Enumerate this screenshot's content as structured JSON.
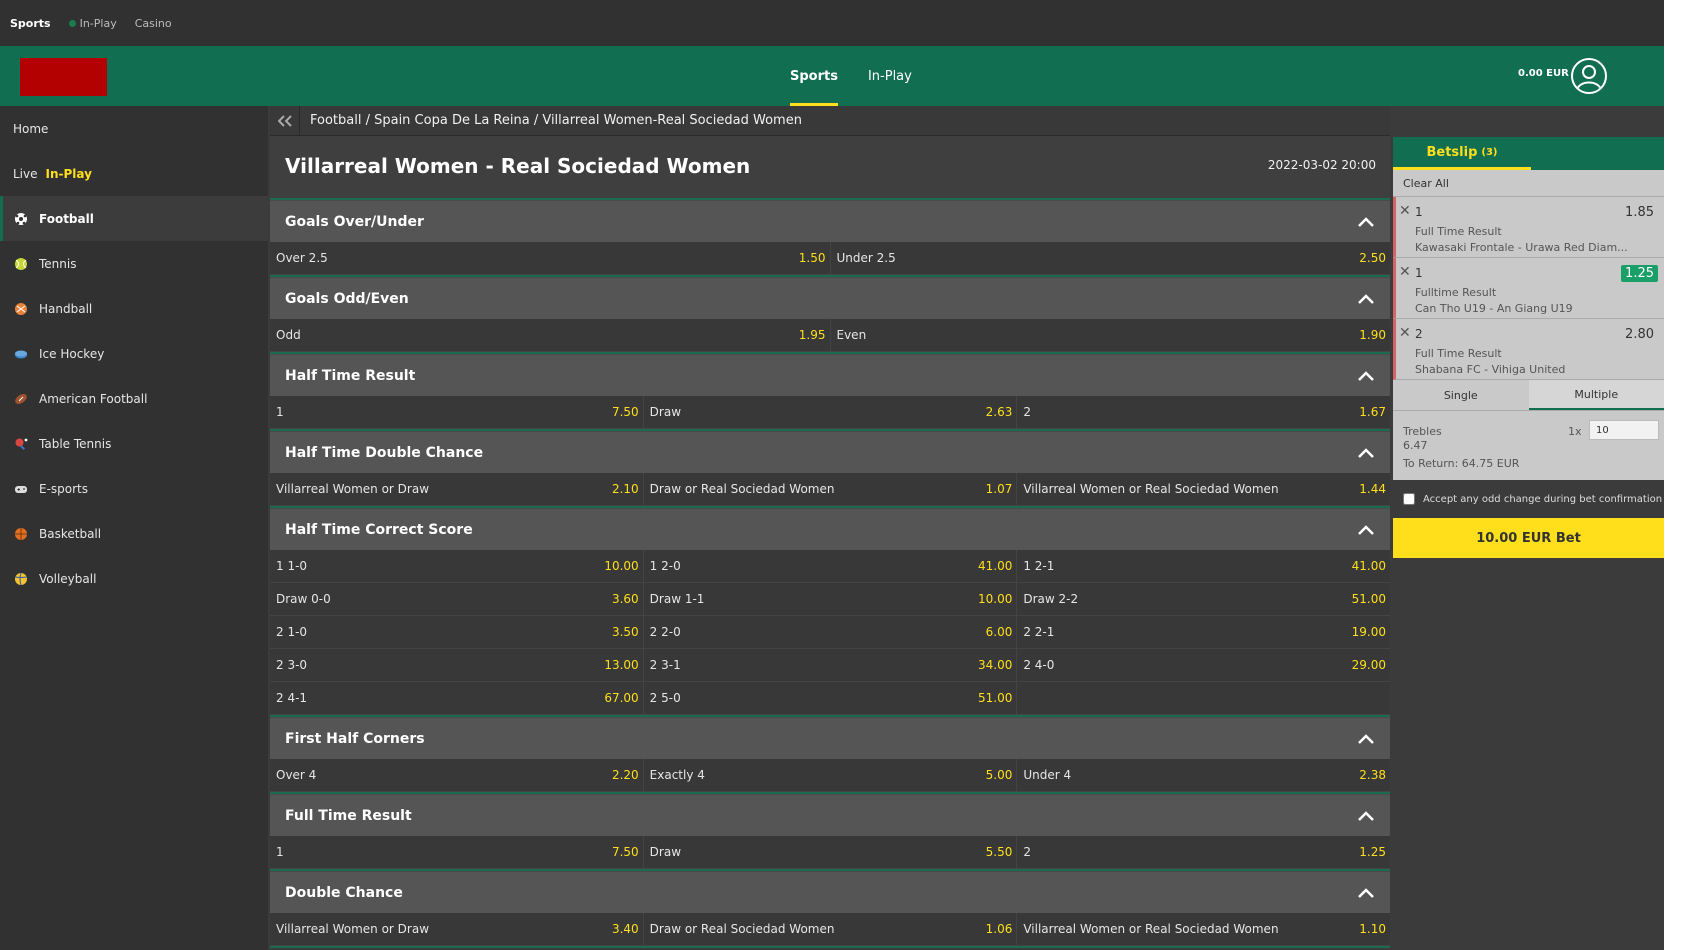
{
  "topbar": {
    "links": [
      {
        "label": "Sports"
      },
      {
        "label": "In-Play"
      },
      {
        "label": "Casino"
      }
    ]
  },
  "header": {
    "nav": [
      {
        "label": "Sports"
      },
      {
        "label": "In-Play"
      }
    ],
    "balance": "0.00 EUR"
  },
  "sidebar": {
    "home": "Home",
    "live": "Live",
    "live_tag": "In-Play",
    "sports": [
      {
        "label": "Football",
        "icon": "soccer-ball-icon"
      },
      {
        "label": "Tennis",
        "icon": "tennis-ball-icon"
      },
      {
        "label": "Handball",
        "icon": "handball-icon"
      },
      {
        "label": "Ice Hockey",
        "icon": "hockey-puck-icon"
      },
      {
        "label": "American Football",
        "icon": "american-football-icon"
      },
      {
        "label": "Table Tennis",
        "icon": "table-tennis-icon"
      },
      {
        "label": "E-sports",
        "icon": "gamepad-icon"
      },
      {
        "label": "Basketball",
        "icon": "basketball-icon"
      },
      {
        "label": "Volleyball",
        "icon": "volleyball-icon"
      }
    ]
  },
  "breadcrumb": "Football / Spain Copa De La Reina / Villarreal Women-Real Sociedad Women",
  "event": {
    "title": "Villarreal Women - Real Sociedad Women",
    "date": "2022-03-02 20:00"
  },
  "markets": [
    {
      "title": "Goals Over/Under",
      "rows": [
        [
          [
            "Over 2.5",
            "1.50"
          ],
          [
            "Under 2.5",
            "2.50"
          ]
        ]
      ]
    },
    {
      "title": "Goals Odd/Even",
      "rows": [
        [
          [
            "Odd",
            "1.95"
          ],
          [
            "Even",
            "1.90"
          ]
        ]
      ]
    },
    {
      "title": "Half Time Result",
      "rows": [
        [
          [
            "1",
            "7.50"
          ],
          [
            "Draw",
            "2.63"
          ],
          [
            "2",
            "1.67"
          ]
        ]
      ]
    },
    {
      "title": "Half Time Double Chance",
      "rows": [
        [
          [
            "Villarreal Women or Draw",
            "2.10"
          ],
          [
            "Draw or Real Sociedad Women",
            "1.07"
          ],
          [
            "Villarreal Women or Real Sociedad Women",
            "1.44"
          ]
        ]
      ]
    },
    {
      "title": "Half Time Correct Score",
      "rows": [
        [
          [
            "1 1-0",
            "10.00"
          ],
          [
            "1 2-0",
            "41.00"
          ],
          [
            "1 2-1",
            "41.00"
          ]
        ],
        [
          [
            "Draw 0-0",
            "3.60"
          ],
          [
            "Draw 1-1",
            "10.00"
          ],
          [
            "Draw 2-2",
            "51.00"
          ]
        ],
        [
          [
            "2 1-0",
            "3.50"
          ],
          [
            "2 2-0",
            "6.00"
          ],
          [
            "2 2-1",
            "19.00"
          ]
        ],
        [
          [
            "2 3-0",
            "13.00"
          ],
          [
            "2 3-1",
            "34.00"
          ],
          [
            "2 4-0",
            "29.00"
          ]
        ],
        [
          [
            "2 4-1",
            "67.00"
          ],
          [
            "2 5-0",
            "51.00"
          ],
          [
            "",
            ""
          ]
        ]
      ]
    },
    {
      "title": "First Half Corners",
      "rows": [
        [
          [
            "Over 4",
            "2.20"
          ],
          [
            "Exactly 4",
            "5.00"
          ],
          [
            "Under 4",
            "2.38"
          ]
        ]
      ]
    },
    {
      "title": "Full Time Result",
      "rows": [
        [
          [
            "1",
            "7.50"
          ],
          [
            "Draw",
            "5.50"
          ],
          [
            "2",
            "1.25"
          ]
        ]
      ]
    },
    {
      "title": "Double Chance",
      "rows": [
        [
          [
            "Villarreal Women or Draw",
            "3.40"
          ],
          [
            "Draw or Real Sociedad Women",
            "1.06"
          ],
          [
            "Villarreal Women or Real Sociedad Women",
            "1.10"
          ]
        ]
      ]
    }
  ],
  "betslip": {
    "tab_label": "Betslip",
    "count": "(3)",
    "clear_all": "Clear All",
    "selections": [
      {
        "pick": "1",
        "odd": "1.85",
        "market": "Full Time Result",
        "event": "Kawasaki Frontale - Urawa Red Diam...",
        "changed": false
      },
      {
        "pick": "1",
        "odd": "1.25",
        "market": "Fulltime Result",
        "event": "Can Tho U19 - An Giang U19",
        "changed": true
      },
      {
        "pick": "2",
        "odd": "2.80",
        "market": "Full Time Result",
        "event": "Shabana FC - Vihiga United",
        "changed": false
      }
    ],
    "types": [
      "Single",
      "Multiple"
    ],
    "multi": {
      "label": "Trebles",
      "odd": "6.47",
      "to_return": "To Return: 64.75 EUR",
      "multiplier": "1x",
      "stake": "10"
    },
    "accept_text": "Accept any odd change during bet confirmation",
    "bet_button": "10.00  EUR Bet"
  },
  "colors": {
    "brand_green": "#126e51",
    "odds_yellow": "#ffdf1b",
    "logo_red": "#b30000"
  }
}
